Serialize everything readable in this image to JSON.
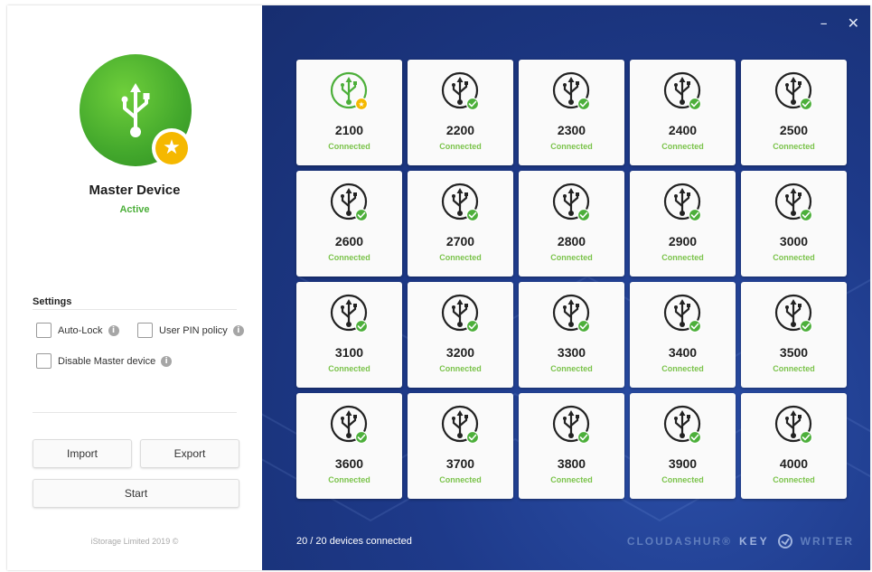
{
  "master": {
    "title": "Master Device",
    "status": "Active",
    "icon": "usb-icon",
    "badge_icon": "star-icon"
  },
  "settings": {
    "heading": "Settings",
    "auto_lock": "Auto-Lock",
    "user_pin_policy": "User PIN policy",
    "disable_master": "Disable Master device",
    "info_glyph": "i"
  },
  "buttons": {
    "import": "Import",
    "export": "Export",
    "start": "Start"
  },
  "footer": {
    "copyright": "iStorage Limited 2019 ©",
    "devices_connected": "20 / 20 devices connected",
    "brand_left": "CLOUDASHUR®",
    "brand_key": "KEY",
    "brand_right": "WRITER"
  },
  "window_controls": {
    "minimize": "–",
    "close": "✕"
  },
  "devices": [
    {
      "id": "2100",
      "status": "Connected",
      "master": true
    },
    {
      "id": "2200",
      "status": "Connected"
    },
    {
      "id": "2300",
      "status": "Connected"
    },
    {
      "id": "2400",
      "status": "Connected"
    },
    {
      "id": "2500",
      "status": "Connected"
    },
    {
      "id": "2600",
      "status": "Connected"
    },
    {
      "id": "2700",
      "status": "Connected"
    },
    {
      "id": "2800",
      "status": "Connected"
    },
    {
      "id": "2900",
      "status": "Connected"
    },
    {
      "id": "3000",
      "status": "Connected"
    },
    {
      "id": "3100",
      "status": "Connected"
    },
    {
      "id": "3200",
      "status": "Connected"
    },
    {
      "id": "3300",
      "status": "Connected"
    },
    {
      "id": "3400",
      "status": "Connected"
    },
    {
      "id": "3500",
      "status": "Connected"
    },
    {
      "id": "3600",
      "status": "Connected"
    },
    {
      "id": "3700",
      "status": "Connected"
    },
    {
      "id": "3800",
      "status": "Connected"
    },
    {
      "id": "3900",
      "status": "Connected"
    },
    {
      "id": "4000",
      "status": "Connected"
    }
  ],
  "colors": {
    "accent_green": "#4caf3a",
    "master_badge": "#f5b800",
    "panel_blue": "#1e3a8a"
  }
}
